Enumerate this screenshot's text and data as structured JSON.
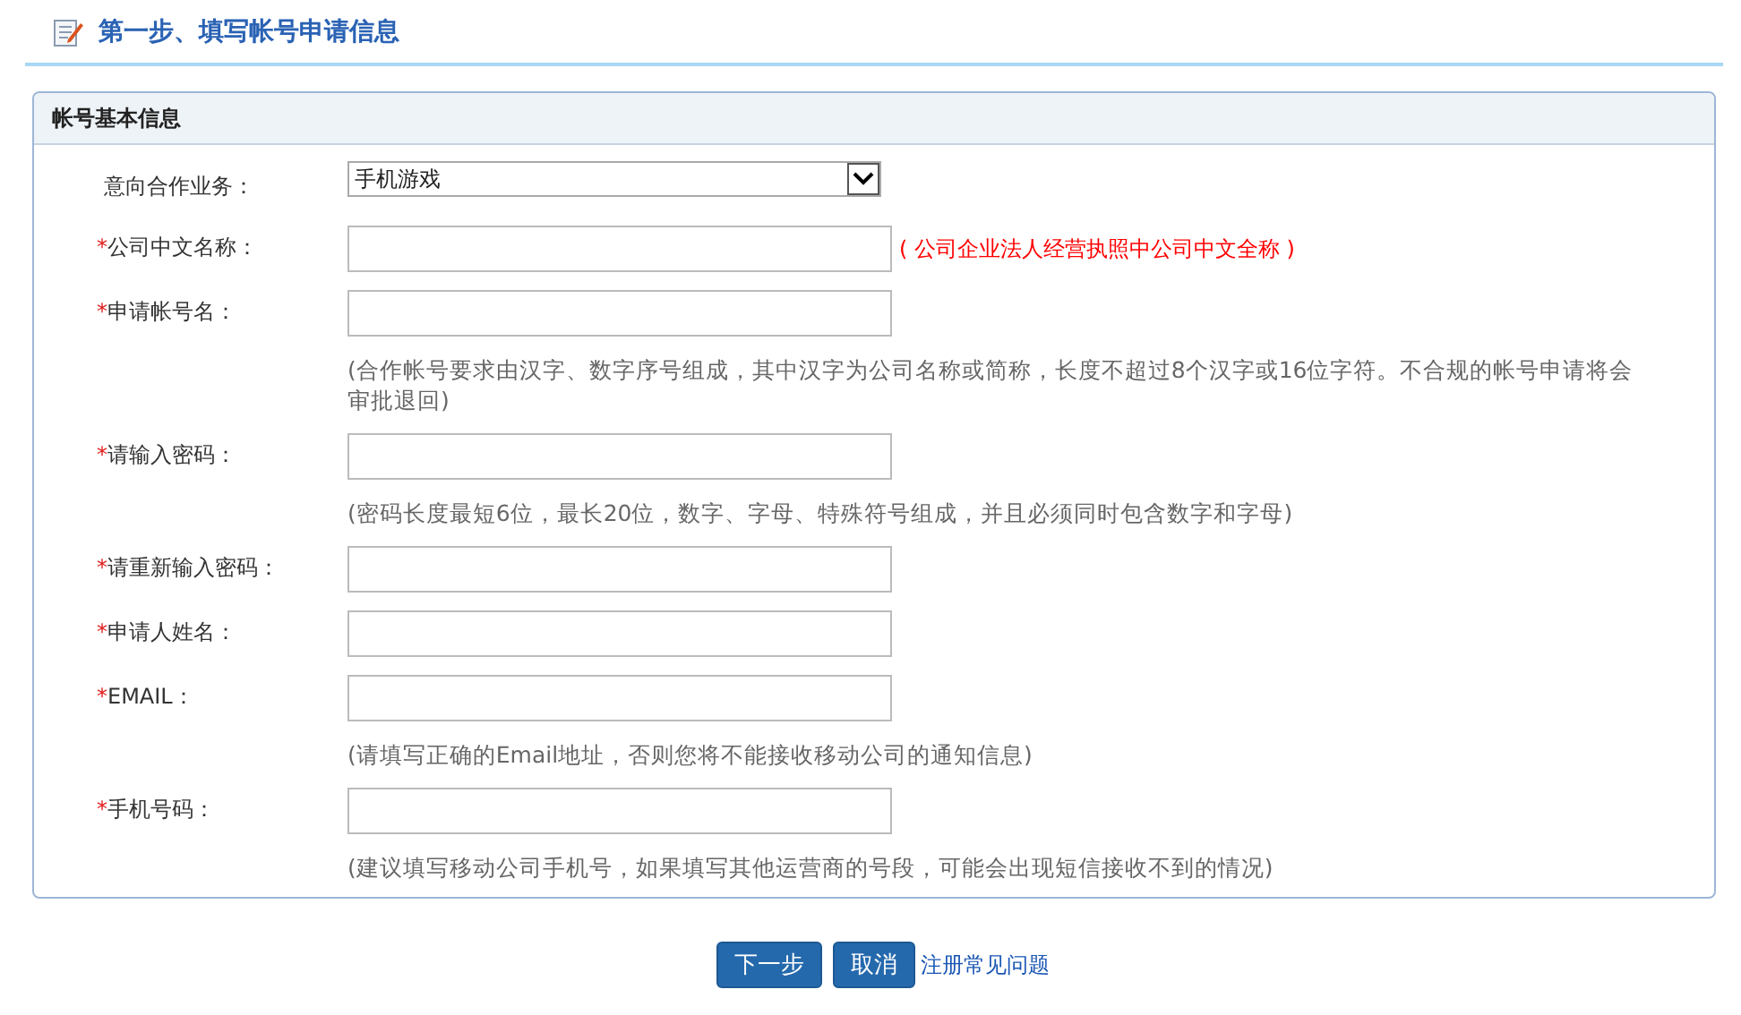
{
  "page_title": "第一步、填写帐号申请信息",
  "panel": {
    "title": "帐号基本信息",
    "fields": [
      {
        "kind": "select",
        "label": "意向合作业务：",
        "value": "手机游戏"
      },
      {
        "kind": "input",
        "marker": "*",
        "label": "公司中文名称：",
        "hint": "( 公司企业法人经营执照中公司中文全称 )"
      },
      {
        "kind": "input",
        "marker": "*",
        "label": "申请帐号名：",
        "note": "(合作帐号要求由汉字、数字序号组成，其中汉字为公司名称或简称，长度不超过8个汉字或16位字符。不合规的帐号申请将会审批退回)"
      },
      {
        "kind": "input",
        "marker": "*",
        "label": "请输入密码：",
        "note": "(密码长度最短6位，最长20位，数字、字母、特殊符号组成，并且必须同时包含数字和字母)"
      },
      {
        "kind": "input",
        "marker": "*",
        "label": "请重新输入密码："
      },
      {
        "kind": "input",
        "marker": "*",
        "label": "申请人姓名："
      },
      {
        "kind": "input",
        "marker": "*",
        "label": "EMAIL：",
        "note": "(请填写正确的Email地址，否则您将不能接收移动公司的通知信息)"
      },
      {
        "kind": "input",
        "marker": "*",
        "label": "手机号码：",
        "note": "(建议填写移动公司手机号，如果填写其他运营商的号段，可能会出现短信接收不到的情况)"
      }
    ]
  },
  "buttons": [
    "下一步",
    "取消"
  ],
  "help_link": "注册常见问题"
}
